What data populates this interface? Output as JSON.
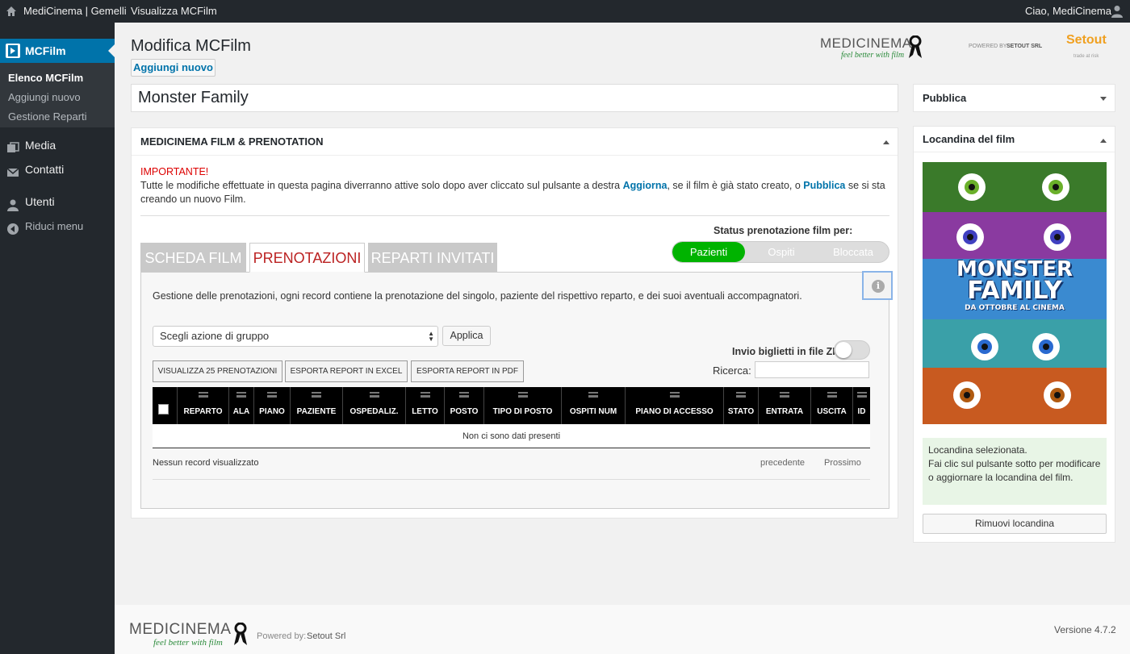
{
  "adminbar": {
    "site_name": "MediCinema | Gemelli",
    "view_link": "Visualizza MCFilm",
    "greeting": "Ciao, MediCinema"
  },
  "sidebar": {
    "items": [
      {
        "label": "MCFilm",
        "icon": "film-icon"
      },
      {
        "label": "Media",
        "icon": "media-icon"
      },
      {
        "label": "Contatti",
        "icon": "mail-icon"
      },
      {
        "label": "Utenti",
        "icon": "user-icon"
      },
      {
        "label": "Riduci menu",
        "icon": "collapse-icon"
      }
    ],
    "submenu": [
      "Elenco MCFilm",
      "Aggiungi nuovo",
      "Gestione Reparti"
    ]
  },
  "header": {
    "title": "Modifica MCFilm",
    "add_new": "Aggiungi nuovo"
  },
  "logos": {
    "medicinema_text": "MEDICINEMA",
    "tagline": "feel better with film",
    "powered_by": "POWERED BY",
    "setout_srl": "SETOUT SRL",
    "setout": "Setout",
    "setout_sub": "trade at risk"
  },
  "post": {
    "title": "Monster Family"
  },
  "metabox": {
    "heading": "MEDICINEMA FILM & PRENOTATION",
    "important": "IMPORTANTE!",
    "notice_part1": "Tutte le modifiche effettuate in questa pagina diverranno attive solo dopo aver cliccato sul pulsante a destra ",
    "notice_link1": "Aggiorna",
    "notice_part2": ", se il film è già stato creato, o ",
    "notice_link2": "Pubblica",
    "notice_part3": " se si sta creando un nuovo Film.",
    "status_label": "Status prenotazione film per:",
    "status_options": [
      "Pazienti",
      "Ospiti",
      "Bloccata"
    ],
    "status_selected": "Pazienti",
    "tabs": [
      "SCHEDA FILM",
      "PRENOTAZIONI",
      "REPARTI INVITATI"
    ],
    "active_tab": "PRENOTAZIONI",
    "description": "Gestione delle prenotazioni, ogni record contiene la prenotazione del singolo, paziente del rispettivo reparto, e dei suoi aventuali accompagnatori.",
    "bulk_action": "Scegli azione di gruppo",
    "apply": "Applica",
    "zip_label": "Invio biglietti in file ZIP",
    "zip_enabled": false,
    "btn_view25": "VISUALIZZA 25 PRENOTAZIONI",
    "btn_excel": "ESPORTA REPORT IN EXCEL",
    "btn_pdf": "ESPORTA REPORT IN PDF",
    "search_label": "Ricerca:",
    "search_value": "",
    "columns": [
      "REPARTO",
      "ALA",
      "PIANO",
      "PAZIENTE",
      "OSPEDALIZ.",
      "LETTO",
      "POSTO",
      "TIPO DI POSTO",
      "OSPITI NUM",
      "PIANO DI ACCESSO",
      "STATO",
      "ENTRATA",
      "USCITA",
      "ID"
    ],
    "empty_text": "Non ci sono dati presenti",
    "records_info": "Nessun record visualizzato",
    "prev": "precedente",
    "next": "Prossimo"
  },
  "publish_box": {
    "heading": "Pubblica"
  },
  "poster_box": {
    "heading": "Locandina del film",
    "poster_title_1": "MONSTER",
    "poster_title_2": "FAMILY",
    "poster_subtitle": "DA OTTOBRE AL CINEMA",
    "selected_text_1": "Locandina selezionata.",
    "selected_text_2": "Fai clic sul pulsante sotto per modificare o aggiornare la locandina del film.",
    "remove_button": "Rimuovi locandina"
  },
  "footer": {
    "logo_text": "MEDICINEMA",
    "tagline": "feel better with film",
    "powered_by": "Powered by:",
    "company": "Setout Srl",
    "version": "Versione 4.7.2"
  },
  "colors": {
    "accent": "#0073aa",
    "admin_bar": "#23282d",
    "status_on": "#00b300",
    "tab_active_text": "#bb2222"
  }
}
